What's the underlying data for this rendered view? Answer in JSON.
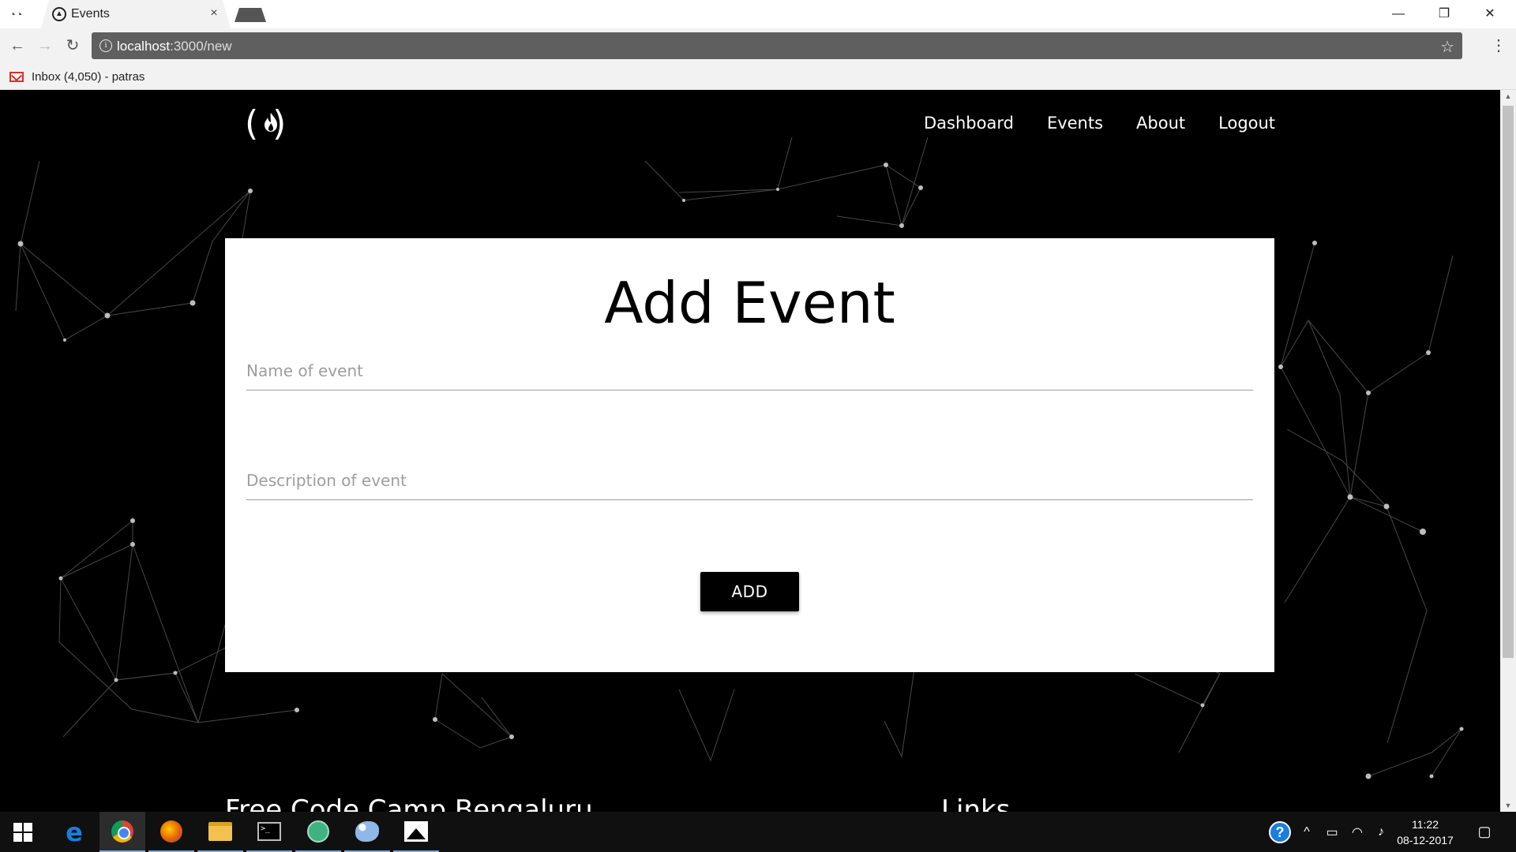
{
  "browser": {
    "tab_title": "Events",
    "tab_close": "×",
    "url_host": "localhost",
    "url_path": ":3000/new",
    "bookmark_label": "Inbox (4,050) - patras",
    "window_min": "—",
    "window_max": "❐",
    "window_close": "✕"
  },
  "nav": {
    "items": [
      {
        "label": "Dashboard"
      },
      {
        "label": "Events"
      },
      {
        "label": "About"
      },
      {
        "label": "Logout"
      }
    ]
  },
  "form": {
    "title": "Add Event",
    "name_placeholder": "Name of event",
    "description_placeholder": "Description of event",
    "submit_label": "ADD"
  },
  "footer": {
    "left_heading": "Free Code Camp Bengaluru",
    "right_heading": "Links"
  },
  "taskbar": {
    "time": "11:22",
    "date": "08-12-2017",
    "apps": [
      "start-icon",
      "edge-icon",
      "chrome-icon",
      "firefox-icon",
      "file-explorer-icon",
      "terminal-icon",
      "atom-icon",
      "paint-icon",
      "photos-icon"
    ]
  },
  "colors": {
    "page_background": "#000000",
    "card_background": "#ffffff",
    "button_background": "#000000",
    "field_underline": "#9e9e9e"
  }
}
